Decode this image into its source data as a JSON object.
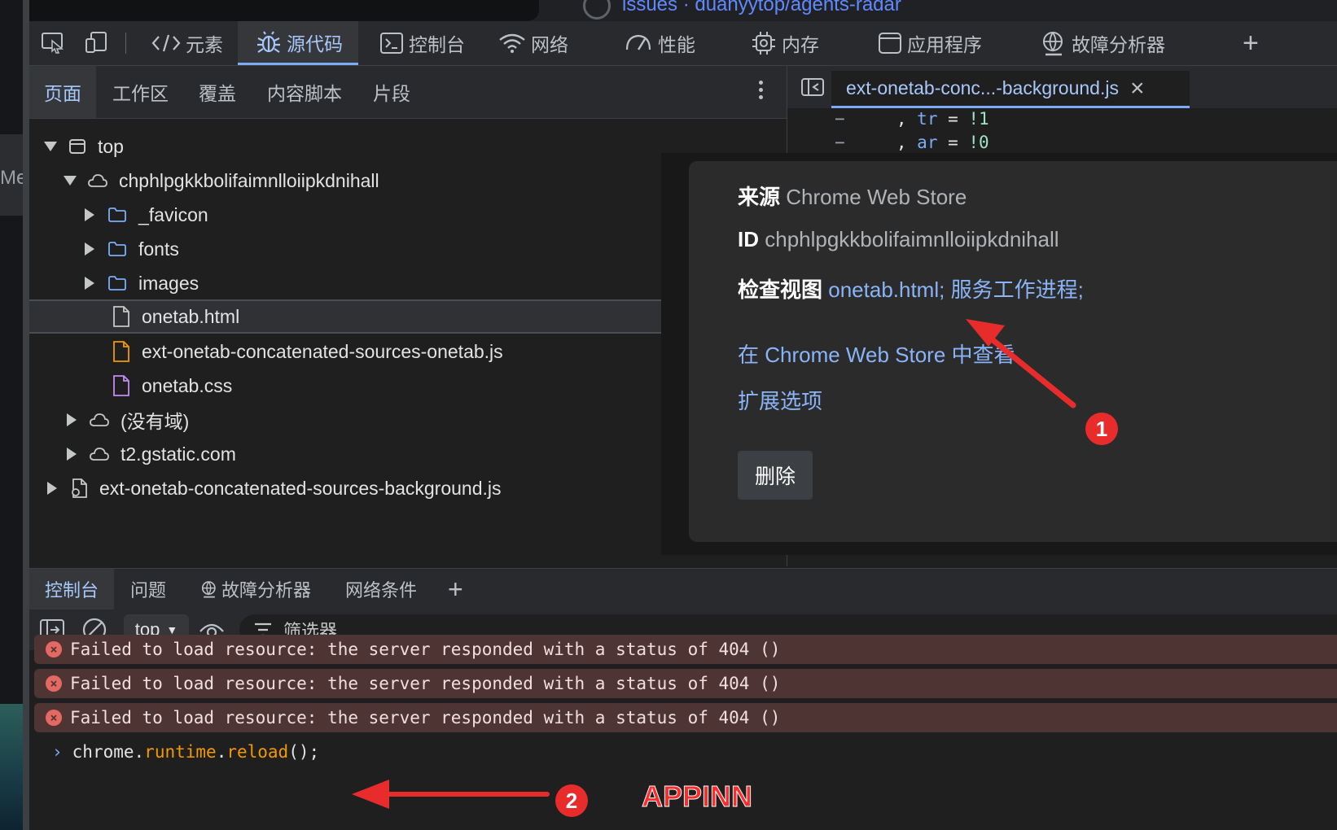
{
  "browser": {
    "page_title": "issues · duanyytop/agents-radar"
  },
  "left_strip": {
    "fragment": "Me"
  },
  "main_toolbar": {
    "tabs": [
      {
        "label": "元素",
        "icon": "code-brackets-icon"
      },
      {
        "label": "源代码",
        "icon": "bug-icon",
        "active": true
      },
      {
        "label": "控制台",
        "icon": "terminal-icon"
      },
      {
        "label": "网络",
        "icon": "wifi-icon"
      },
      {
        "label": "性能",
        "icon": "gauge-icon"
      },
      {
        "label": "内存",
        "icon": "chip-icon"
      },
      {
        "label": "应用程序",
        "icon": "window-icon"
      },
      {
        "label": "故障分析器",
        "icon": "globe-person-icon"
      }
    ],
    "add_label": "+"
  },
  "navigator": {
    "tabs": [
      "页面",
      "工作区",
      "覆盖",
      "内容脚本",
      "片段"
    ],
    "tree": [
      {
        "label": "top",
        "indent": 0,
        "toggle": "down",
        "icon": "frame-icon"
      },
      {
        "label": "chphlpgkkbolifaimnlloiipkdnihall",
        "indent": 1,
        "toggle": "down",
        "icon": "cloud-icon"
      },
      {
        "label": "_favicon",
        "indent": 2,
        "toggle": "right",
        "icon": "folder-icon"
      },
      {
        "label": "fonts",
        "indent": 2,
        "toggle": "right",
        "icon": "folder-icon"
      },
      {
        "label": "images",
        "indent": 2,
        "toggle": "right",
        "icon": "folder-icon"
      },
      {
        "label": "onetab.html",
        "indent": 3,
        "toggle": "none",
        "icon": "file-html-icon",
        "selected": true
      },
      {
        "label": "ext-onetab-concatenated-sources-onetab.js",
        "indent": 3,
        "toggle": "none",
        "icon": "file-js-icon"
      },
      {
        "label": "onetab.css",
        "indent": 3,
        "toggle": "none",
        "icon": "file-css-icon"
      },
      {
        "label": "(没有域)",
        "indent": 1,
        "toggle": "right",
        "icon": "cloud-icon"
      },
      {
        "label": "t2.gstatic.com",
        "indent": 1,
        "toggle": "right",
        "icon": "cloud-icon"
      },
      {
        "label": "ext-onetab-concatenated-sources-background.js",
        "indent": 0,
        "toggle": "right",
        "icon": "worker-file-icon"
      }
    ]
  },
  "editor": {
    "tab_label": "ext-onetab-conc...-background.js",
    "lines": [
      {
        "marker": "−",
        "text_prefix": ", ",
        "var": "tr",
        "eq": " = ",
        "val": "!1"
      },
      {
        "marker": "−",
        "text_prefix": ", ",
        "var": "ar",
        "eq": " = ",
        "val": "!0"
      }
    ]
  },
  "popup": {
    "source_label": "来源",
    "source_value": "Chrome Web Store",
    "id_label": "ID",
    "id_value": "chphlpgkkbolifaimnlloiipkdnihall",
    "views_label": "检查视图",
    "view_link_1": "onetab.html;",
    "view_link_2": "服务工作进程;",
    "store_link": "在 Chrome Web Store 中查看",
    "options_link": "扩展选项",
    "remove_label": "删除"
  },
  "drawer": {
    "tabs": [
      "控制台",
      "问题",
      "故障分析器",
      "网络条件"
    ],
    "add_label": "+",
    "context": "top",
    "filter_placeholder": "筛选器"
  },
  "console": {
    "messages": [
      "Failed to load resource: the server responded with a status of 404 ()",
      "Failed to load resource: the server responded with a status of 404 ()",
      "Failed to load resource: the server responded with a status of 404 ()"
    ],
    "input": {
      "p1": "chrome",
      "dot1": ".",
      "p2": "runtime",
      "dot2": ".",
      "p3": "reload",
      "rest": "();"
    }
  },
  "annotations": {
    "badge_1": "1",
    "badge_2": "2",
    "watermark": "APPINN",
    "arrow_color": "#e82c2c"
  }
}
